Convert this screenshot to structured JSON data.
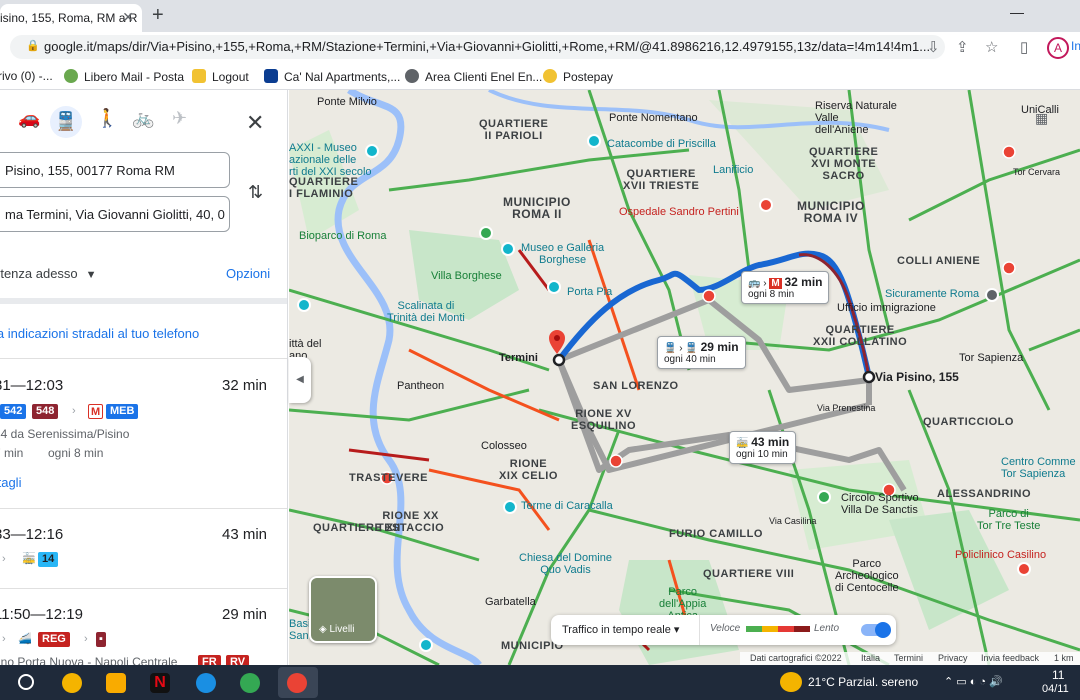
{
  "browser": {
    "tab_title": "isino, 155, Roma, RM a R",
    "url": "google.it/maps/dir/Via+Pisino,+155,+Roma,+RM/Stazione+Termini,+Via+Giovanni+Giolitti,+Rome,+RM/@41.8986216,12.4979155,13z/data=!4m14!4m1...",
    "profile_initial": "A",
    "profile_extra": "In"
  },
  "bookmarks": [
    {
      "label": "rivo (0) -...",
      "color": "#1a73e8"
    },
    {
      "label": "Libero Mail - Posta",
      "color": "#6aa84f"
    },
    {
      "label": "Logout",
      "color": "#f1c232"
    },
    {
      "label": "Ca' Nal Apartments,...",
      "color": "#0b3d91"
    },
    {
      "label": "Area Clienti Enel En...",
      "color": "#5f6368"
    },
    {
      "label": "Postepay",
      "color": "#f1c232"
    }
  ],
  "panel": {
    "origin": "Pisino, 155, 00177 Roma RM",
    "destination": "ma Termini, Via Giovanni Giolitti, 40, 0",
    "departure": "rtenza adesso",
    "options": "Opzioni",
    "send_to_phone": "ia indicazioni stradali al tuo telefono",
    "details": "ttagli",
    "routes": [
      {
        "time": "31—12:03",
        "duration": "32 min",
        "badges": [
          "542",
          "548",
          "MEB"
        ],
        "line1": "34 da Serenissima/Pisino",
        "line2a": "7 min",
        "line2b": "ogni 8 min"
      },
      {
        "time": "33—12:16",
        "duration": "43 min",
        "badges": [
          "14"
        ]
      },
      {
        "time": "11:50—12:19",
        "duration": "29 min",
        "badges": [
          "REG"
        ],
        "line1": "rino Porta Nuova - Napoli Centrale",
        "extra_badges": [
          "FR",
          "RV"
        ]
      }
    ]
  },
  "map": {
    "labels": {
      "ponte_milvio": "Ponte Milvio",
      "q_parioli": "QUARTIERE\nII PARIOLI",
      "ponte_nomentano": "Ponte Nomentano",
      "axxi": "AXXI - Museo\nazionale delle\nrti del XXI secolo",
      "catacombe": "Catacombe di Priscilla",
      "q_flaminio": "QUARTIERE\nI FLAMINIO",
      "q_trieste": "QUARTIERE\nXVII TRIESTE",
      "lanificio": "Lanificio",
      "municipio_ii": "MUNICIPIO\nROMA II",
      "pertini": "Ospedale Sandro Pertini",
      "q_monte_sacro": "QUARTIERE\nXVI MONTE\nSACRO",
      "riserva": "Riserva Naturale\nValle\ndell'Aniene",
      "municipio_iv": "MUNICIPIO\nROMA IV",
      "biopark": "Bioparco di Roma",
      "museo_galleria": "Museo e Galleria\nBorghese",
      "villa_borghese": "Villa Borghese",
      "colli_aniene": "COLLI ANIENE",
      "porta_pia": "Porta Pia",
      "sicuramente": "Sicuramente Roma",
      "ufficio_imm": "Ufficio immigrazione",
      "scalinata": "Scalinata di\nTrinità dei Monti",
      "q_collatino": "QUARTIERE\nXXII COLLATINO",
      "citta": "ittà del\nano",
      "termini": "Termini",
      "pantheon": "Pantheon",
      "san_lorenzo": "SAN LORENZO",
      "tor_sapienza": "Tor Sapienza",
      "via_pisino": "Via Pisino, 155",
      "rione_xv": "RIONE XV\nESQUILINO",
      "via_prenestina": "Via Prenestina",
      "colosseo": "Colosseo",
      "quarticciolo": "QUARTICCIOLO",
      "trastevere": "TRASTEVERE",
      "rione_xix": "RIONE\nXIX CELIO",
      "centro_comm": "Centro Comme\nTor Sapienza",
      "alessandrino": "ALESSANDRINO",
      "terme": "Terme di Caracalla",
      "rione_xx": "RIONE XX\nTESTACCIO",
      "q_xii": "QUARTIERE XII",
      "circolo": "Circolo Sportivo\nVilla De Sanctis",
      "tor_tre_teste": "Parco di\nTor Tre Teste",
      "furio_camillo": "FURIO CAMILLO",
      "q_viii": "QUARTIERE VIII",
      "via_casilina": "Via Casilina",
      "casilino": "Policlinico Casilino",
      "chiesa": "Chiesa del Domine\nQuo Vadis",
      "parco_arch": "Parco\nArcheologico\ndi Centocelle",
      "garbatella": "Garbatella",
      "appia": "Parco\ndell'Appia\nAntica",
      "municipio_bottom": "MUNICIPIO",
      "basilica": "Basilica Papale\nSan Paolo",
      "unicalli": "UniCalli",
      "tor_cervara": "Tor Cervara"
    },
    "callout_metro": {
      "duration": "32 min",
      "freq": "ogni 8 min"
    },
    "callout_train": {
      "duration": "29 min",
      "freq": "ogni 40 min"
    },
    "callout_bus": {
      "duration": "43 min",
      "freq": "ogni 10 min"
    },
    "layers_label": "Livelli",
    "traffic_label": "Traffico in tempo reale",
    "legend_fast": "Veloce",
    "legend_slow": "Lento",
    "footer": {
      "data": "Dati cartografici ©2022",
      "country": "Italia",
      "terms": "Termini",
      "privacy": "Privacy",
      "feedback": "Invia feedback",
      "scale": "1 km"
    }
  },
  "taskbar": {
    "weather": "21°C  Parzial. sereno",
    "clock_time": "11",
    "clock_date": "04/11"
  }
}
